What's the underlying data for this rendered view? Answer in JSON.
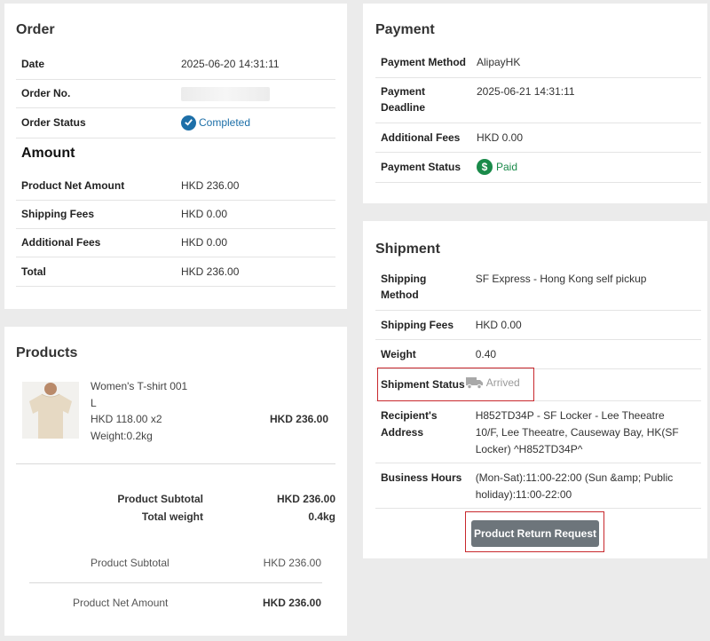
{
  "order": {
    "title": "Order",
    "rows": [
      {
        "label": "Date",
        "value": "2025-06-20 14:31:11"
      },
      {
        "label": "Order No.",
        "value": ""
      },
      {
        "label": "Order Status",
        "value": "Completed",
        "icon": "check-circle-icon"
      }
    ]
  },
  "amount": {
    "title": "Amount",
    "rows": [
      {
        "label": "Product Net Amount",
        "value": "HKD 236.00"
      },
      {
        "label": "Shipping Fees",
        "value": "HKD 0.00"
      },
      {
        "label": "Additional Fees",
        "value": "HKD 0.00"
      },
      {
        "label": "Total",
        "value": "HKD 236.00"
      }
    ]
  },
  "payment": {
    "title": "Payment",
    "rows": [
      {
        "label": "Payment Method",
        "value": "AlipayHK"
      },
      {
        "label": "Payment Deadline",
        "value": "2025-06-21 14:31:11"
      },
      {
        "label": "Additional Fees",
        "value": "HKD 0.00"
      },
      {
        "label": "Payment Status",
        "value": "Paid",
        "icon": "dollar-circle-icon"
      }
    ]
  },
  "shipment": {
    "title": "Shipment",
    "rows": [
      {
        "label": "Shipping Method",
        "value": "SF Express - Hong Kong self pickup"
      },
      {
        "label": "Shipping Fees",
        "value": "HKD 0.00"
      },
      {
        "label": "Weight",
        "value": "0.40"
      },
      {
        "label": "Shipment Status",
        "value": "Arrived",
        "icon": "truck-icon"
      },
      {
        "label": "Recipient's Address",
        "value": "H852TD34P - SF Locker - Lee Theeatre 10/F, Lee Theeatre, Causeway Bay, HK(SF Locker) ^H852TD34P^"
      },
      {
        "label": "Business Hours",
        "value": "(Mon-Sat):11:00-22:00 (Sun &amp; Public holiday):11:00-22:00"
      }
    ],
    "return_button": "Product Return Request"
  },
  "products": {
    "title": "Products",
    "items": [
      {
        "name": "Women's T-shirt 001",
        "size": "L",
        "price_qty": "HKD 118.00 x2",
        "weight": "Weight:0.2kg",
        "line_total": "HKD 236.00"
      }
    ],
    "summary": [
      {
        "label": "Product Subtotal",
        "value": "HKD 236.00"
      },
      {
        "label": "Total weight",
        "value": "0.4kg"
      }
    ],
    "summary2": [
      {
        "label": "Product Subtotal",
        "value": "HKD 236.00"
      },
      {
        "label": "Product Net Amount",
        "value": "HKD 236.00"
      }
    ]
  },
  "colors": {
    "completed": "#1d6fa8",
    "paid": "#1a8a4a",
    "arrived": "#9a9a9a",
    "highlight": "#c8282d",
    "button": "#6d757b"
  }
}
